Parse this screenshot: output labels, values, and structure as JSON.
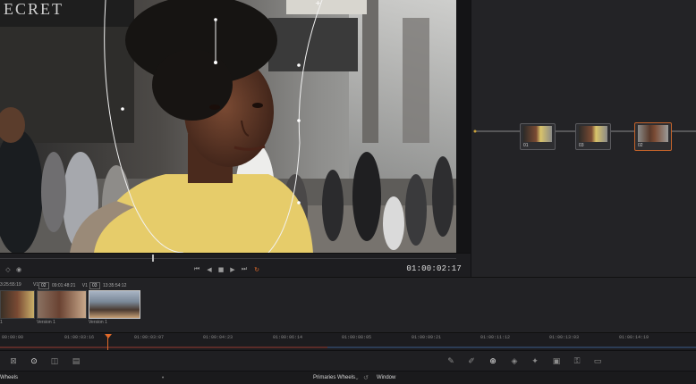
{
  "viewer": {
    "sign_text": "ECRET",
    "timecode": "01:00:02:17"
  },
  "transport": {
    "left_icon_1": "loop-icon",
    "left_icon_2": "audio-icon",
    "buttons": [
      {
        "name": "skip-back-icon",
        "glyph": "⏮"
      },
      {
        "name": "step-back-icon",
        "glyph": "◀"
      },
      {
        "name": "stop-icon",
        "glyph": "■"
      },
      {
        "name": "play-icon",
        "glyph": "▶"
      },
      {
        "name": "skip-forward-icon",
        "glyph": "⏭"
      },
      {
        "name": "loop-playback-icon",
        "glyph": "↻"
      }
    ]
  },
  "clips": [
    {
      "timecode": "3:25:55:19",
      "track": "V1",
      "label": "1"
    },
    {
      "index": "02",
      "timecode": "09:01:48:21",
      "track": "V1",
      "label": "Version 1"
    },
    {
      "index": "03",
      "timecode": "13:35:54:12",
      "track": "V1",
      "label": "Version 1"
    }
  ],
  "nodes": [
    {
      "label": "01"
    },
    {
      "label": "03"
    },
    {
      "label": "02"
    }
  ],
  "timeline": {
    "ticks": [
      "00:00:00",
      "01:00:03:16",
      "01:00:03:07",
      "01:00:04:23",
      "01:00:06:14",
      "01:00:08:05",
      "01:00:09:21",
      "01:00:11:12",
      "01:00:13:03",
      "01:00:14:19"
    ]
  },
  "palette": {
    "left_label": "Wheels",
    "center_label": "Primaries Wheels",
    "right_label": "Window"
  },
  "colors": {
    "accent_orange": "#e06a2a",
    "background": "#1b1b1d",
    "node_selected": "#c4632a"
  }
}
